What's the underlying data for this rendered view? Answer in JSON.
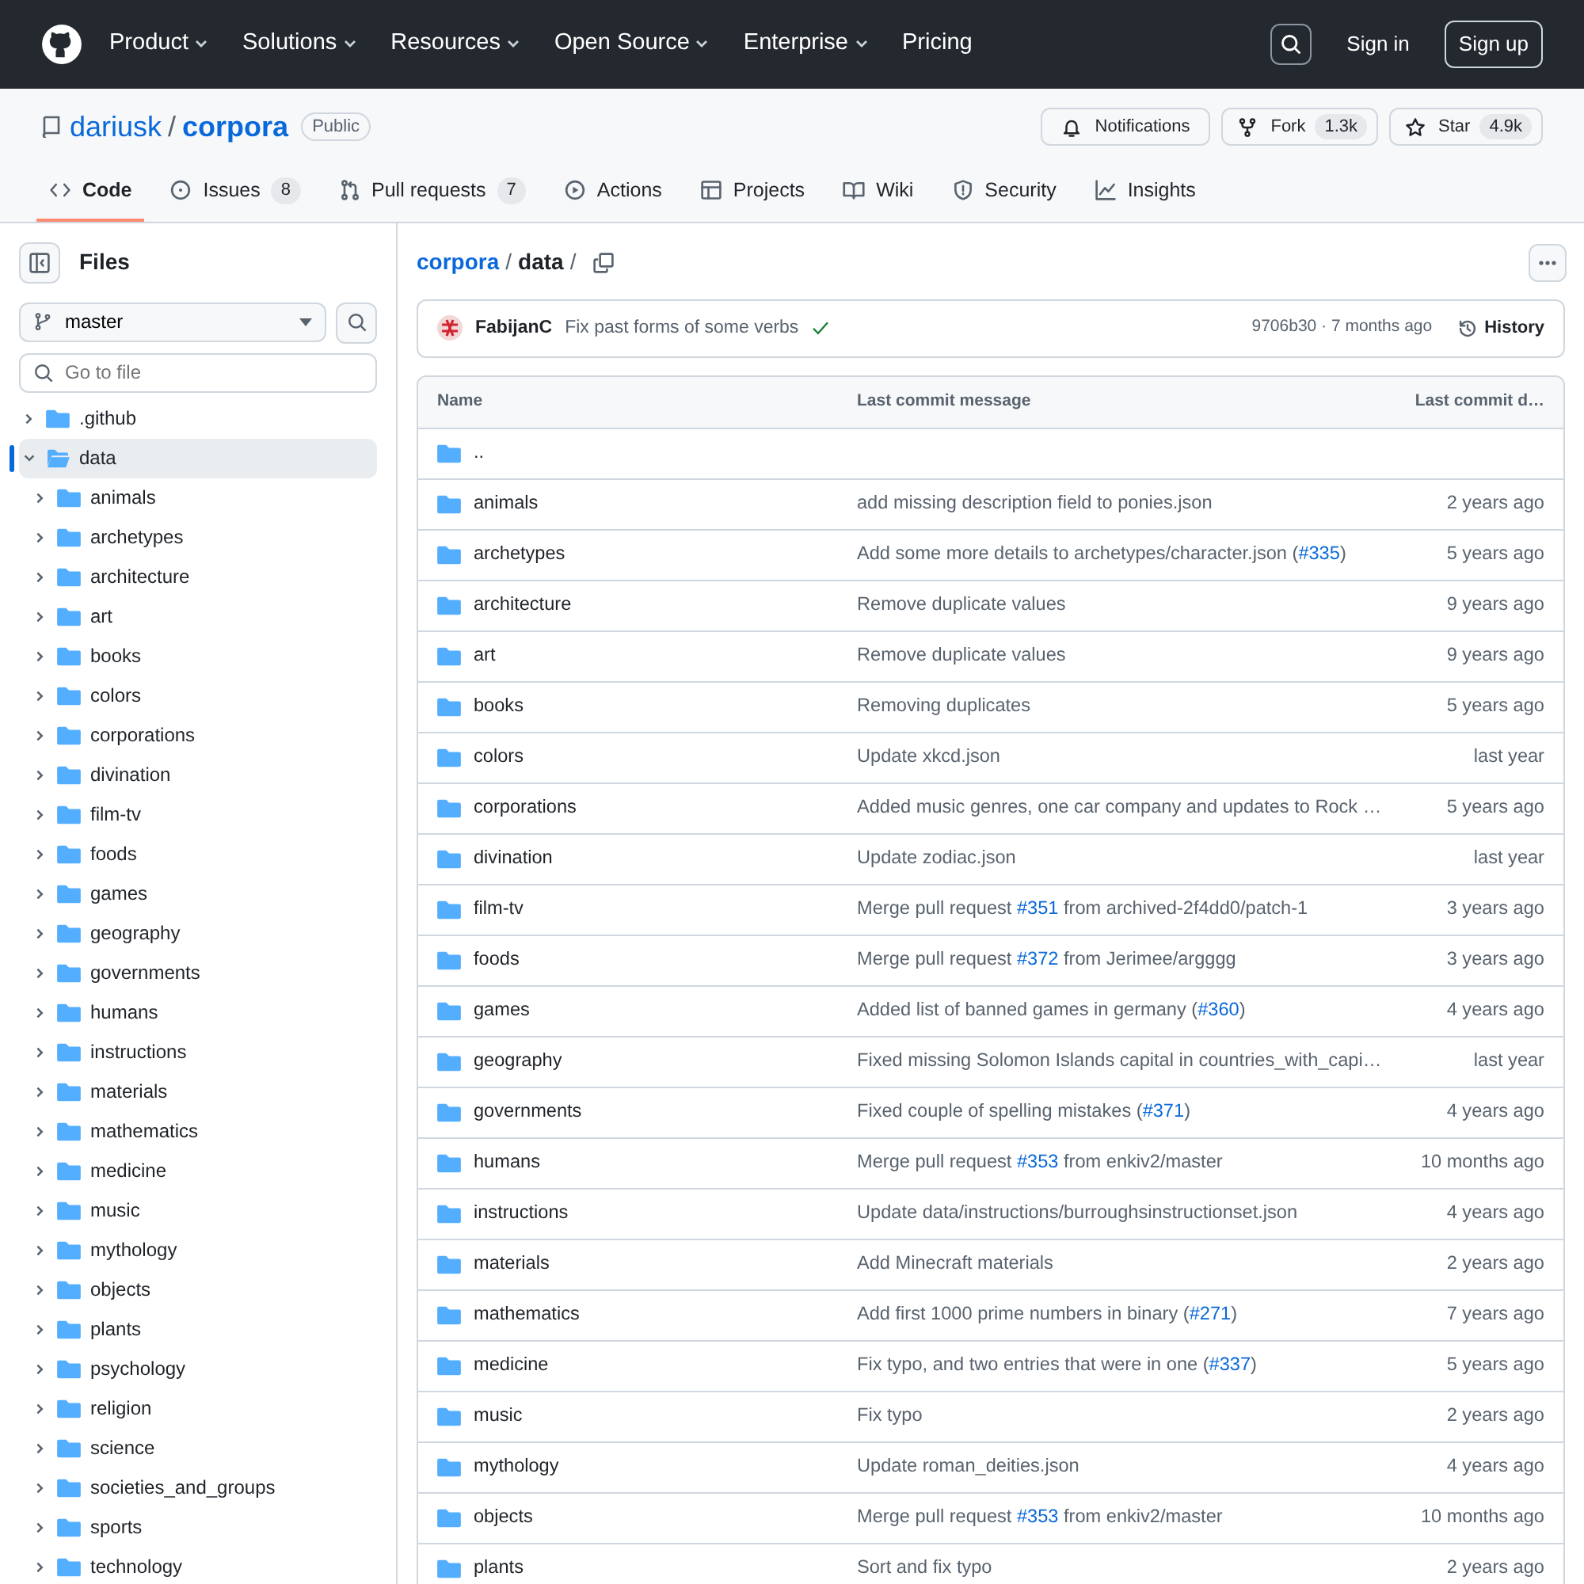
{
  "top_nav": {
    "items": [
      {
        "label": "Product",
        "has_menu": true
      },
      {
        "label": "Solutions",
        "has_menu": true
      },
      {
        "label": "Resources",
        "has_menu": true
      },
      {
        "label": "Open Source",
        "has_menu": true
      },
      {
        "label": "Enterprise",
        "has_menu": true
      },
      {
        "label": "Pricing",
        "has_menu": false
      }
    ],
    "sign_in": "Sign in",
    "sign_up": "Sign up"
  },
  "repo": {
    "owner": "dariusk",
    "separator": "/",
    "name": "corpora",
    "visibility": "Public",
    "actions": [
      {
        "label": "Notifications"
      },
      {
        "label": "Fork",
        "count": "1.3k"
      },
      {
        "label": "Star",
        "count": "4.9k"
      }
    ]
  },
  "tabs": [
    {
      "label": "Code",
      "selected": true
    },
    {
      "label": "Issues",
      "count": "8",
      "selected": false
    },
    {
      "label": "Pull requests",
      "count": "7",
      "selected": false
    },
    {
      "label": "Actions",
      "selected": false
    },
    {
      "label": "Projects",
      "selected": false
    },
    {
      "label": "Wiki",
      "selected": false
    },
    {
      "label": "Security",
      "selected": false
    },
    {
      "label": "Insights",
      "selected": false
    }
  ],
  "sidebar": {
    "title": "Files",
    "branch": "master",
    "search": {
      "placeholder": "Go to file"
    },
    "tree": [
      {
        "name": ".github",
        "expanded": false,
        "selected": false
      },
      {
        "name": "data",
        "expanded": true,
        "selected": true,
        "children": [
          {
            "name": "animals",
            "expanded": false,
            "selected": false
          },
          {
            "name": "archetypes",
            "expanded": false,
            "selected": false
          },
          {
            "name": "architecture",
            "expanded": false,
            "selected": false
          },
          {
            "name": "art",
            "expanded": false,
            "selected": false
          },
          {
            "name": "books",
            "expanded": false,
            "selected": false
          },
          {
            "name": "colors",
            "expanded": false,
            "selected": false
          },
          {
            "name": "corporations",
            "expanded": false,
            "selected": false
          },
          {
            "name": "divination",
            "expanded": false,
            "selected": false
          },
          {
            "name": "film-tv",
            "expanded": false,
            "selected": false
          },
          {
            "name": "foods",
            "expanded": false,
            "selected": false
          },
          {
            "name": "games",
            "expanded": false,
            "selected": false
          },
          {
            "name": "geography",
            "expanded": false,
            "selected": false
          },
          {
            "name": "governments",
            "expanded": false,
            "selected": false
          },
          {
            "name": "humans",
            "expanded": false,
            "selected": false
          },
          {
            "name": "instructions",
            "expanded": false,
            "selected": false
          },
          {
            "name": "materials",
            "expanded": false,
            "selected": false
          },
          {
            "name": "mathematics",
            "expanded": false,
            "selected": false
          },
          {
            "name": "medicine",
            "expanded": false,
            "selected": false
          },
          {
            "name": "music",
            "expanded": false,
            "selected": false
          },
          {
            "name": "mythology",
            "expanded": false,
            "selected": false
          },
          {
            "name": "objects",
            "expanded": false,
            "selected": false
          },
          {
            "name": "plants",
            "expanded": false,
            "selected": false
          },
          {
            "name": "psychology",
            "expanded": false,
            "selected": false
          },
          {
            "name": "religion",
            "expanded": false,
            "selected": false
          },
          {
            "name": "science",
            "expanded": false,
            "selected": false
          },
          {
            "name": "societies_and_groups",
            "expanded": false,
            "selected": false
          },
          {
            "name": "sports",
            "expanded": false,
            "selected": false
          },
          {
            "name": "technology",
            "expanded": false,
            "selected": false
          }
        ]
      }
    ]
  },
  "breadcrumb": [
    {
      "text": "corpora",
      "kind": "link"
    },
    {
      "text": "/",
      "kind": "separator"
    },
    {
      "text": "data",
      "kind": "current"
    },
    {
      "text": "/",
      "kind": "separator"
    }
  ],
  "commit": {
    "author": "FabijanC",
    "message": "Fix past forms of some verbs",
    "checks_passed": true,
    "meta": "9706b30 · 7 months ago",
    "history": "History"
  },
  "table": {
    "columns": [
      "Name",
      "Last commit message",
      "Last commit d…"
    ],
    "parent_row": "..",
    "rows": [
      {
        "name": "animals",
        "message": [
          {
            "kind": "text",
            "text": "add missing description field to ponies.json"
          }
        ],
        "date": "2 years ago"
      },
      {
        "name": "archetypes",
        "message": [
          {
            "kind": "text",
            "text": "Add some more details to archetypes/character.json ("
          },
          {
            "kind": "link",
            "text": "#335"
          },
          {
            "kind": "text",
            "text": ")"
          }
        ],
        "date": "5 years ago"
      },
      {
        "name": "architecture",
        "message": [
          {
            "kind": "text",
            "text": "Remove duplicate values"
          }
        ],
        "date": "9 years ago"
      },
      {
        "name": "art",
        "message": [
          {
            "kind": "text",
            "text": "Remove duplicate values"
          }
        ],
        "date": "9 years ago"
      },
      {
        "name": "books",
        "message": [
          {
            "kind": "text",
            "text": "Removing duplicates"
          }
        ],
        "date": "5 years ago"
      },
      {
        "name": "colors",
        "message": [
          {
            "kind": "text",
            "text": "Update xkcd.json"
          }
        ],
        "date": "last year"
      },
      {
        "name": "corporations",
        "message": [
          {
            "kind": "text",
            "text": "Added music genres, one car company and updates to Rock …"
          }
        ],
        "date": "5 years ago"
      },
      {
        "name": "divination",
        "message": [
          {
            "kind": "text",
            "text": "Update zodiac.json"
          }
        ],
        "date": "last year"
      },
      {
        "name": "film-tv",
        "message": [
          {
            "kind": "text",
            "text": "Merge pull request "
          },
          {
            "kind": "link",
            "text": "#351"
          },
          {
            "kind": "text",
            "text": " from archived-2f4dd0/patch-1"
          }
        ],
        "date": "3 years ago"
      },
      {
        "name": "foods",
        "message": [
          {
            "kind": "text",
            "text": "Merge pull request "
          },
          {
            "kind": "link",
            "text": "#372"
          },
          {
            "kind": "text",
            "text": " from Jerimee/argggg"
          }
        ],
        "date": "3 years ago"
      },
      {
        "name": "games",
        "message": [
          {
            "kind": "text",
            "text": "Added list of banned games in germany ("
          },
          {
            "kind": "link",
            "text": "#360"
          },
          {
            "kind": "text",
            "text": ")"
          }
        ],
        "date": "4 years ago"
      },
      {
        "name": "geography",
        "message": [
          {
            "kind": "text",
            "text": "Fixed missing Solomon Islands capital in countries_with_capi…"
          }
        ],
        "date": "last year"
      },
      {
        "name": "governments",
        "message": [
          {
            "kind": "text",
            "text": "Fixed couple of spelling mistakes ("
          },
          {
            "kind": "link",
            "text": "#371"
          },
          {
            "kind": "text",
            "text": ")"
          }
        ],
        "date": "4 years ago"
      },
      {
        "name": "humans",
        "message": [
          {
            "kind": "text",
            "text": "Merge pull request "
          },
          {
            "kind": "link",
            "text": "#353"
          },
          {
            "kind": "text",
            "text": " from enkiv2/master"
          }
        ],
        "date": "10 months ago"
      },
      {
        "name": "instructions",
        "message": [
          {
            "kind": "text",
            "text": "Update data/instructions/burroughsinstructionset.json"
          }
        ],
        "date": "4 years ago"
      },
      {
        "name": "materials",
        "message": [
          {
            "kind": "text",
            "text": "Add Minecraft materials"
          }
        ],
        "date": "2 years ago"
      },
      {
        "name": "mathematics",
        "message": [
          {
            "kind": "text",
            "text": "Add first 1000 prime numbers in binary ("
          },
          {
            "kind": "link",
            "text": "#271"
          },
          {
            "kind": "text",
            "text": ")"
          }
        ],
        "date": "7 years ago"
      },
      {
        "name": "medicine",
        "message": [
          {
            "kind": "text",
            "text": "Fix typo, and two entries that were in one ("
          },
          {
            "kind": "link",
            "text": "#337"
          },
          {
            "kind": "text",
            "text": ")"
          }
        ],
        "date": "5 years ago"
      },
      {
        "name": "music",
        "message": [
          {
            "kind": "text",
            "text": "Fix typo"
          }
        ],
        "date": "2 years ago"
      },
      {
        "name": "mythology",
        "message": [
          {
            "kind": "text",
            "text": "Update roman_deities.json"
          }
        ],
        "date": "4 years ago"
      },
      {
        "name": "objects",
        "message": [
          {
            "kind": "text",
            "text": "Merge pull request "
          },
          {
            "kind": "link",
            "text": "#353"
          },
          {
            "kind": "text",
            "text": " from enkiv2/master"
          }
        ],
        "date": "10 months ago"
      },
      {
        "name": "plants",
        "message": [
          {
            "kind": "text",
            "text": "Sort and fix typo"
          }
        ],
        "date": "2 years ago"
      }
    ]
  }
}
